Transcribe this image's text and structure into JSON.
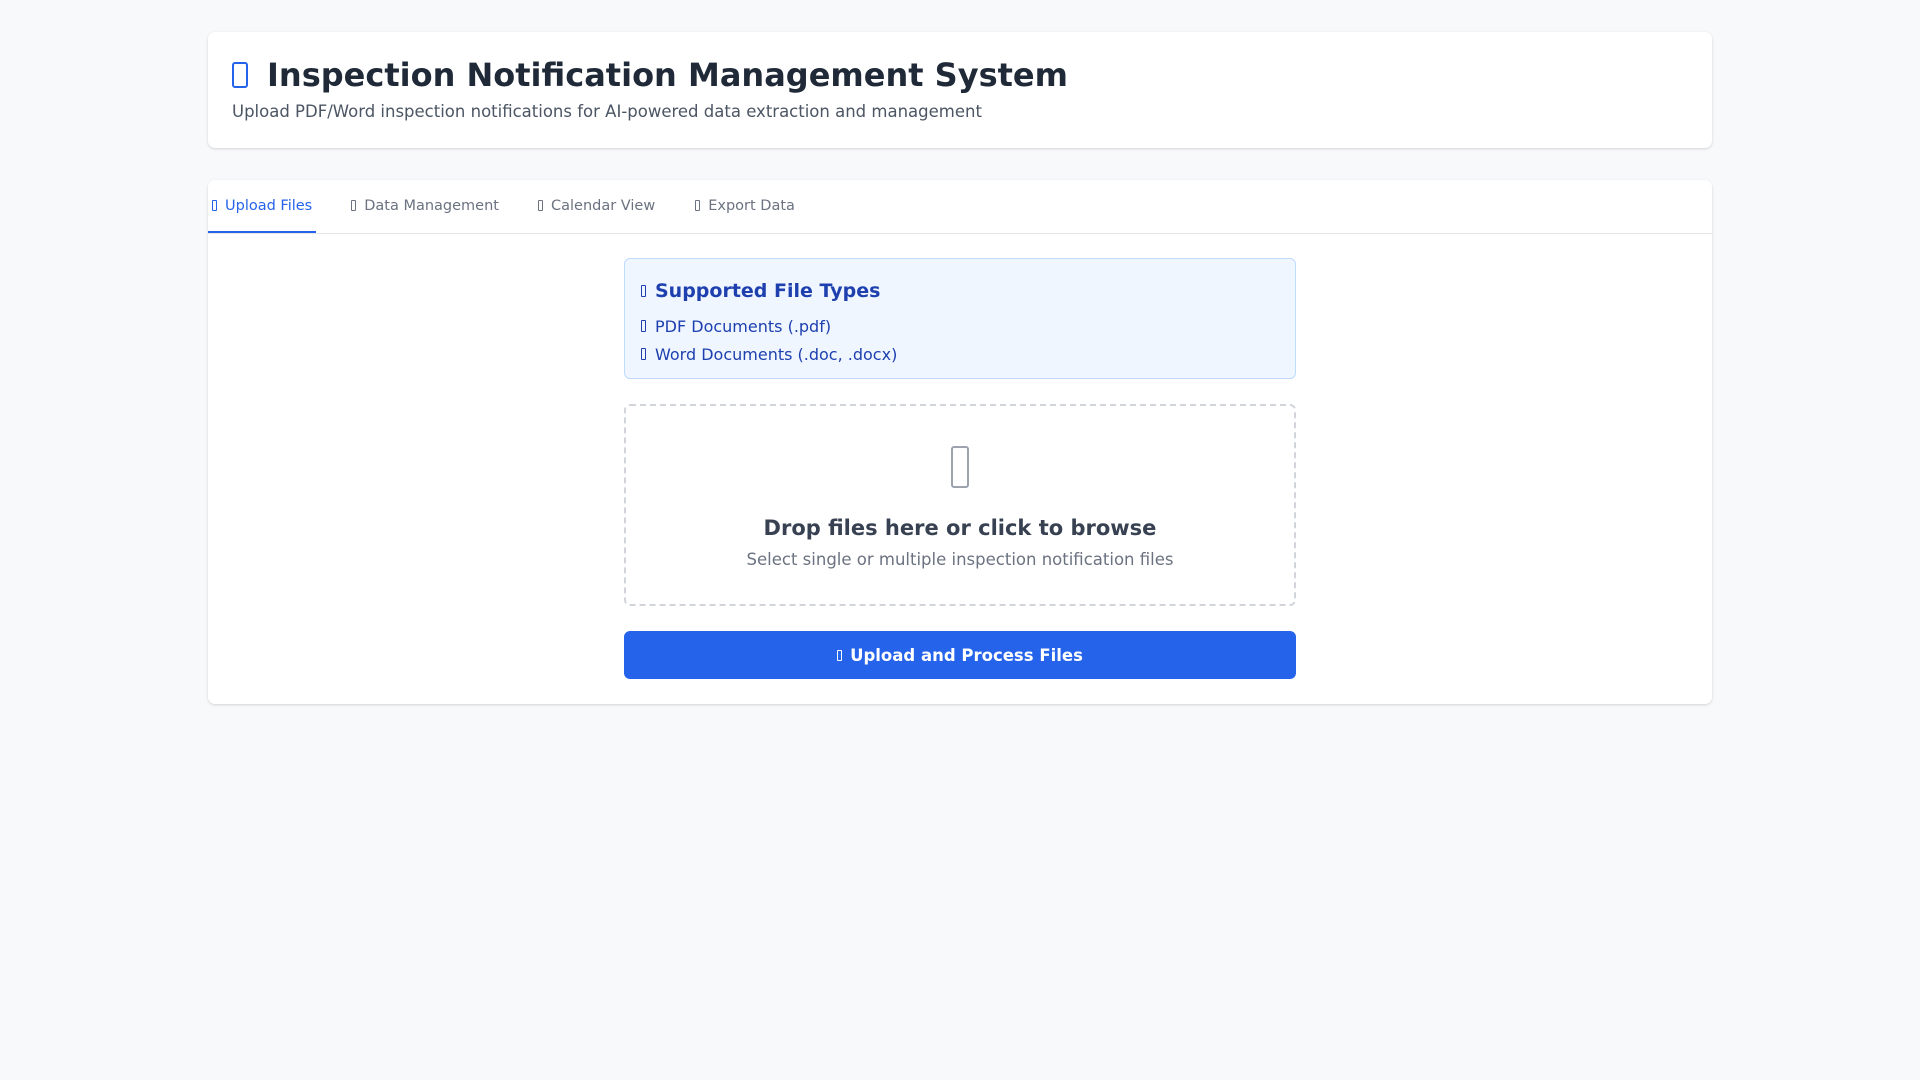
{
  "header": {
    "icon": "document-icon",
    "title": "Inspection Notification Management System",
    "subtitle": "Upload PDF/Word inspection notifications for AI-powered data extraction and management"
  },
  "tabs": [
    {
      "label": "Upload Files",
      "icon": "upload-icon",
      "active": true
    },
    {
      "label": "Data Management",
      "icon": "database-icon",
      "active": false
    },
    {
      "label": "Calendar View",
      "icon": "calendar-icon",
      "active": false
    },
    {
      "label": "Export Data",
      "icon": "download-icon",
      "active": false
    }
  ],
  "supported": {
    "icon": "info-icon",
    "title": "Supported File Types",
    "items": [
      {
        "icon": "file-pdf-icon",
        "label": "PDF Documents (.pdf)"
      },
      {
        "icon": "file-word-icon",
        "label": "Word Documents (.doc, .docx)"
      }
    ]
  },
  "dropzone": {
    "icon": "cloud-upload-icon",
    "title": "Drop files here or click to browse",
    "subtitle": "Select single or multiple inspection notification files"
  },
  "upload_button": {
    "icon": "upload-icon",
    "label": "Upload and Process Files"
  },
  "colors": {
    "accent": "#2563eb",
    "background": "#f8f9fb",
    "info_bg": "#eff6ff",
    "info_text": "#1e40af"
  }
}
